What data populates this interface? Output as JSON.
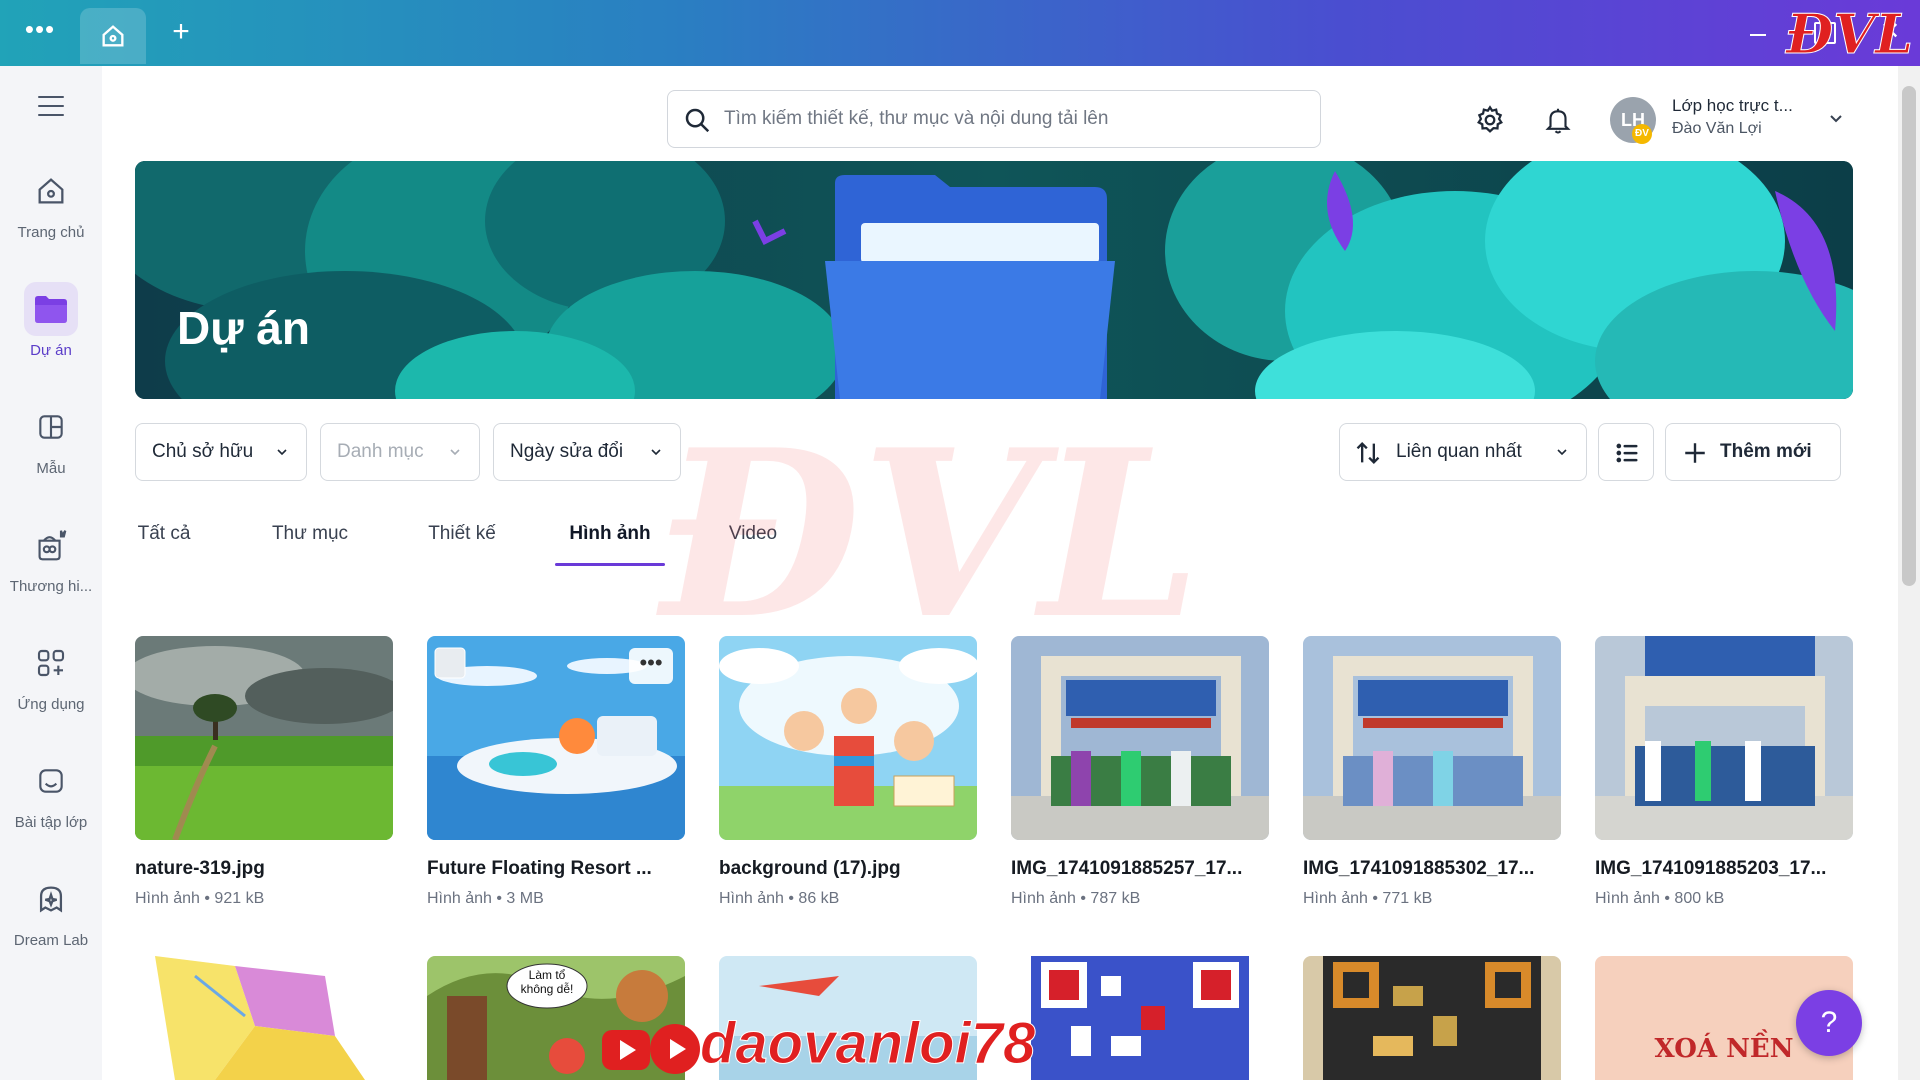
{
  "titlebar": {
    "menu_glyph": "•••",
    "add_glyph": "+",
    "close_glyph": "✕",
    "logo_text": "ĐVL"
  },
  "sidebar": {
    "items": [
      {
        "label": "Trang chủ",
        "icon": "home-icon"
      },
      {
        "label": "Dự án",
        "icon": "folder-icon"
      },
      {
        "label": "Mẫu",
        "icon": "template-icon"
      },
      {
        "label": "Thương hi...",
        "icon": "brand-icon"
      },
      {
        "label": "Ứng dụng",
        "icon": "apps-icon"
      },
      {
        "label": "Bài tập lớp",
        "icon": "assignment-icon"
      },
      {
        "label": "Dream Lab",
        "icon": "dream-lab-icon"
      }
    ]
  },
  "header": {
    "search_placeholder": "Tìm kiếm thiết kế, thư mục và nội dung tải lên",
    "account_initials": "LH",
    "account_badge": "ĐV",
    "account_name": "Lớp học trực t...",
    "account_user": "Đào Văn Lợi"
  },
  "banner": {
    "title": "Dự án"
  },
  "filters": {
    "owner": "Chủ sở hữu",
    "category": "Danh mục",
    "modified": "Ngày sửa đổi",
    "sort": "Liên quan nhất",
    "add_new": "Thêm mới"
  },
  "tabs": [
    "Tất cả",
    "Thư mục",
    "Thiết kế",
    "Hình ảnh",
    "Video"
  ],
  "active_tab": "Hình ảnh",
  "items": [
    {
      "name": "nature-319.jpg",
      "meta": "Hình ảnh • 921 kB"
    },
    {
      "name": "Future Floating Resort ...",
      "meta": "Hình ảnh • 3 MB"
    },
    {
      "name": "background (17).jpg",
      "meta": "Hình ảnh • 86 kB"
    },
    {
      "name": "IMG_1741091885257_17...",
      "meta": "Hình ảnh • 787 kB"
    },
    {
      "name": "IMG_1741091885302_17...",
      "meta": "Hình ảnh • 771 kB"
    },
    {
      "name": "IMG_1741091885203_17...",
      "meta": "Hình ảnh • 800 kB"
    }
  ],
  "second_row": {
    "bubble_text": "Làm tổ không dễ!",
    "xoa_nen": "XOÁ NỀN",
    "overlay": "daovanloi78",
    "center_watermark": "ĐVL"
  },
  "help_label": "?",
  "colors": {
    "accent": "#6a3ad8",
    "titlebar_start": "#21a3b8",
    "titlebar_end": "#6a3ad8"
  }
}
